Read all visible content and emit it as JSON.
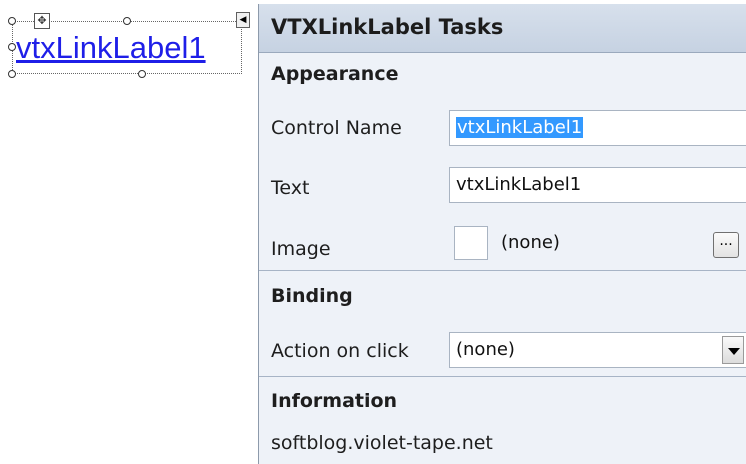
{
  "designer": {
    "link_label_text": "vtxLinkLabel1"
  },
  "panel": {
    "title": "VTXLinkLabel Tasks",
    "appearance": {
      "section_title": "Appearance",
      "control_name_label": "Control Name",
      "control_name_value": "vtxLinkLabel1",
      "text_label": "Text",
      "text_value": "vtxLinkLabel1",
      "image_label": "Image",
      "image_value": "(none)",
      "browse_button_label": "..."
    },
    "binding": {
      "section_title": "Binding",
      "action_label": "Action on click",
      "action_value": "(none)"
    },
    "information": {
      "section_title": "Information",
      "site_text": "softblog.violet-tape.net"
    }
  },
  "colors": {
    "link": "#1f1fe8",
    "selection": "#3399ff",
    "panel_bg": "#eef2f8",
    "header_bg": "#c6d2e2"
  }
}
